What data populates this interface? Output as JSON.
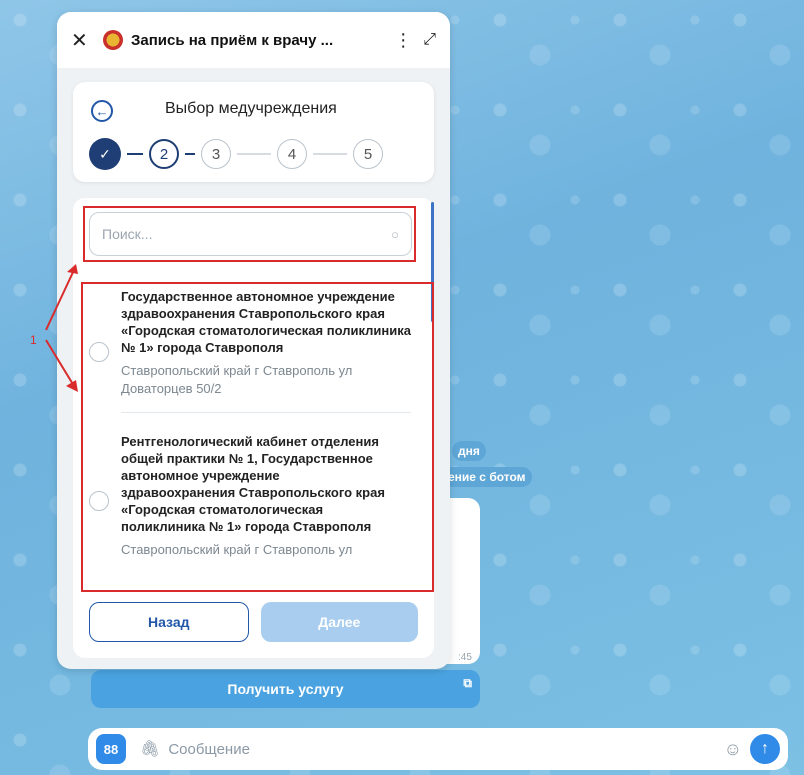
{
  "panel": {
    "title": "Запись на приём к врачу ...",
    "step_title": "Выбор медучреждения",
    "steps": [
      "2",
      "3",
      "4",
      "5"
    ],
    "search_placeholder": "Поиск...",
    "organizations": [
      {
        "name": "Государственное автономное учреждение здравоохранения Ставропольского края «Городская стоматологическая поликлиника № 1» города Ставрополя",
        "address": "Ставропольский край г Ставрополь ул Доваторцев 50/2"
      },
      {
        "name": "Рентгенологический кабинет отделения общей практики № 1, Государственное автономное учреждение здравоохранения Ставропольского края «Городская стоматологическая поликлиника № 1» города Ставрополя",
        "address": "Ставропольский край г Ставрополь ул"
      }
    ],
    "back_label": "Назад",
    "next_label": "Далее"
  },
  "chat": {
    "fragment_day": "дня",
    "fragment_bot": "ение с ботом",
    "msg_time": ":45",
    "service_button": "Получить услугу",
    "composer_placeholder": "Сообщение"
  },
  "annotation": {
    "label": "1"
  },
  "colors": {
    "accent": "#1e3e75",
    "highlight": "#d92b2b",
    "button_disabled": "#a8cdee"
  }
}
